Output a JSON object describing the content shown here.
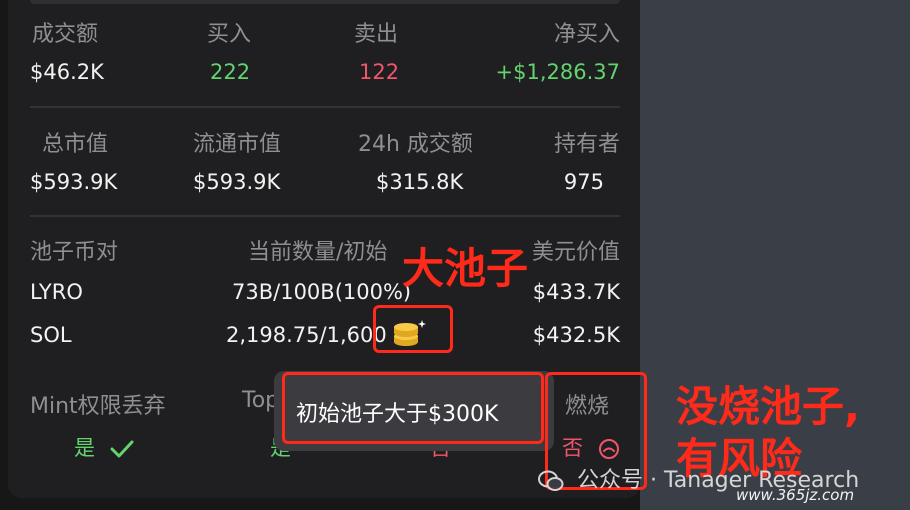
{
  "trade": {
    "headers": [
      "成交额",
      "买入",
      "卖出",
      "净买入"
    ],
    "values": [
      "$46.2K",
      "222",
      "122",
      "+$1,286.37"
    ]
  },
  "market": {
    "headers": [
      "总市值",
      "流通市值",
      "24h 成交额",
      "持有者"
    ],
    "values": [
      "$593.9K",
      "$593.9K",
      "$315.8K",
      "975"
    ]
  },
  "pool": {
    "headers": [
      "池子币对",
      "当前数量/初始",
      "美元价值"
    ],
    "rows": [
      {
        "pair": "LYRO",
        "amount": "73B/100B(100%)",
        "usd": "$433.7K"
      },
      {
        "pair": "SOL",
        "amount": "2,198.75/1,600",
        "usd": "$432.5K"
      }
    ]
  },
  "security": {
    "headers": [
      "Mint权限丢弃",
      "Top",
      "燃烧"
    ],
    "mint_value": "是",
    "top_value": "是",
    "mid_value": "否",
    "burn_value": "否"
  },
  "tooltip": {
    "text": "初始池子大于$300K"
  },
  "annotations": {
    "big_pool": "大池子",
    "no_burn_line1": "没烧池子,",
    "no_burn_line2": "有风险"
  },
  "watermark": {
    "text": "公众号 · Tanager Research",
    "site": "www.365jz.com"
  },
  "colors": {
    "green": "#63d36e",
    "red": "#f0566b",
    "annotation": "#ff2a1a"
  }
}
